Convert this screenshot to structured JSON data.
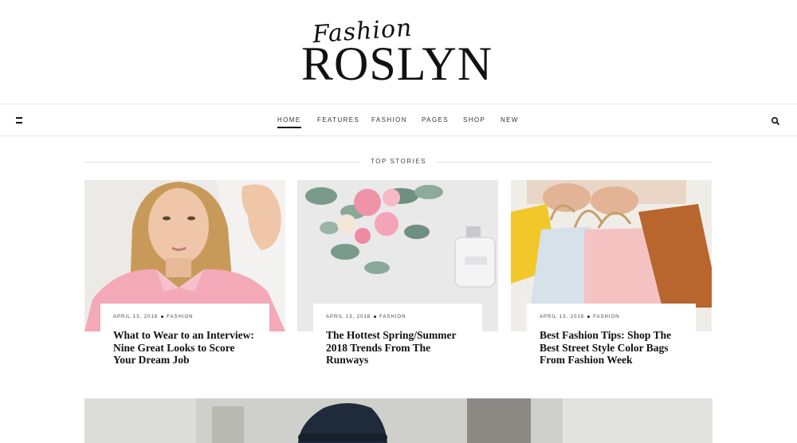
{
  "logo": {
    "script": "Fashion",
    "main": "ROSLYN"
  },
  "nav": {
    "items": [
      {
        "label": "HOME",
        "active": true
      },
      {
        "label": "FEATURES",
        "active": false
      },
      {
        "label": "FASHION",
        "active": false
      },
      {
        "label": "PAGES",
        "active": false
      },
      {
        "label": "SHOP",
        "active": false
      },
      {
        "label": "NEW",
        "active": false
      }
    ]
  },
  "section": {
    "title": "TOP STORIES"
  },
  "cards": [
    {
      "date": "APRIL 13, 2018",
      "category": "FASHION",
      "title": "What to Wear to an Interview: Nine Great Looks to Score Your Dream Job"
    },
    {
      "date": "APRIL 13, 2018",
      "category": "FASHION",
      "title": "The Hottest Spring/Summer 2018 Trends From The Runways"
    },
    {
      "date": "APRIL 13, 2018",
      "category": "FASHION",
      "title": "Best Fashion Tips: Shop The Best Street Style Color Bags From Fashion Week"
    }
  ],
  "images": {
    "card1": "woman-pink-blouse-photo",
    "card2": "flowers-perfume-photo",
    "card3": "colorful-bags-photo",
    "featured": "woman-black-hat-photo"
  },
  "colors": {
    "accent": "#111111",
    "divider": "#e6e6e6",
    "blouse": "#f3a9b7",
    "bag_yellow": "#f2c72a",
    "bag_brown": "#b8652e"
  },
  "icons": {
    "menu": "menu-icon",
    "search": "search-icon"
  }
}
